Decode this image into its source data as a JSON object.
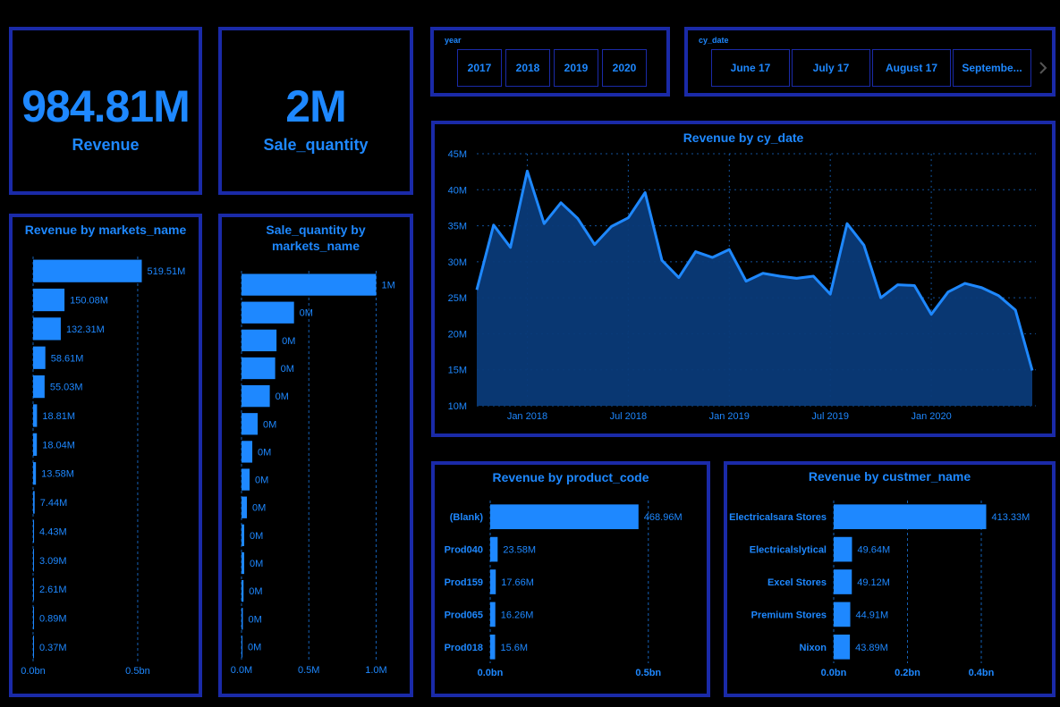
{
  "kpis": {
    "revenue": {
      "value": "984.81M",
      "label": "Revenue"
    },
    "quantity": {
      "value": "2M",
      "label": "Sale_quantity"
    }
  },
  "year_slicer": {
    "title": "year",
    "options": [
      "2017",
      "2018",
      "2019",
      "2020"
    ]
  },
  "date_slicer": {
    "title": "cy_date",
    "options": [
      "June 17",
      "July 17",
      "August 17",
      "Septembe..."
    ],
    "next_icon": "chevron-right-icon"
  },
  "colors": {
    "accent": "#1e88ff",
    "border": "#1a2aa8",
    "area_fill": "#0a3a78",
    "background": "#000000"
  },
  "chart_data": [
    {
      "id": "revenue_by_market",
      "type": "bar",
      "orientation": "horizontal",
      "title": "Revenue by markets_name",
      "categories": [
        "",
        "",
        "",
        "",
        "",
        "",
        "",
        "",
        "",
        "",
        "",
        "",
        "",
        ""
      ],
      "values": [
        519.51,
        150.08,
        132.31,
        58.61,
        55.03,
        18.81,
        18.04,
        13.58,
        7.44,
        4.43,
        3.09,
        2.61,
        0.89,
        0.37
      ],
      "data_labels": [
        "519.51M",
        "150.08M",
        "132.31M",
        "58.61M",
        "55.03M",
        "18.81M",
        "18.04M",
        "13.58M",
        "7.44M",
        "4.43M",
        "3.09M",
        "2.61M",
        "0.89M",
        "0.37M"
      ],
      "xlim": [
        0,
        620
      ],
      "xticks": [
        0,
        500
      ],
      "xtick_labels": [
        "0.0bn",
        "0.5bn"
      ],
      "grid": true
    },
    {
      "id": "quantity_by_market",
      "type": "bar",
      "orientation": "horizontal",
      "title": "Sale_quantity by markets_name",
      "categories": [
        "",
        "",
        "",
        "",
        "",
        "",
        "",
        "",
        "",
        "",
        "",
        "",
        "",
        ""
      ],
      "values": [
        1.0,
        0.39,
        0.26,
        0.25,
        0.21,
        0.12,
        0.08,
        0.06,
        0.04,
        0.02,
        0.02,
        0.015,
        0.01,
        0.005
      ],
      "data_labels": [
        "1M",
        "0M",
        "0M",
        "0M",
        "0M",
        "0M",
        "0M",
        "0M",
        "0M",
        "0M",
        "0M",
        "0M",
        "0M",
        "0M"
      ],
      "xlim": [
        0,
        1.05
      ],
      "xticks": [
        0,
        0.5,
        1.0
      ],
      "xtick_labels": [
        "0.0M",
        "0.5M",
        "1.0M"
      ],
      "grid": true
    },
    {
      "id": "revenue_by_date",
      "type": "area",
      "title": "Revenue by cy_date",
      "x": [
        "2017-10",
        "2017-11",
        "2017-12",
        "2018-01",
        "2018-02",
        "2018-03",
        "2018-04",
        "2018-05",
        "2018-06",
        "2018-07",
        "2018-08",
        "2018-09",
        "2018-10",
        "2018-11",
        "2018-12",
        "2019-01",
        "2019-02",
        "2019-03",
        "2019-04",
        "2019-05",
        "2019-06",
        "2019-07",
        "2019-08",
        "2019-09",
        "2019-10",
        "2019-11",
        "2019-12",
        "2020-01",
        "2020-02",
        "2020-03",
        "2020-04",
        "2020-05",
        "2020-06"
      ],
      "values": [
        26.1,
        35.1,
        32.0,
        42.6,
        35.3,
        38.2,
        36.0,
        32.4,
        34.9,
        36.1,
        39.6,
        30.2,
        27.8,
        31.4,
        30.6,
        31.7,
        27.3,
        28.4,
        28.0,
        27.7,
        28.0,
        25.5,
        35.3,
        32.3,
        25.0,
        26.8,
        26.7,
        22.7,
        25.8,
        27.0,
        26.4,
        25.3,
        23.3,
        14.9
      ],
      "yticks": [
        10,
        15,
        20,
        25,
        30,
        35,
        40,
        45
      ],
      "ytick_labels": [
        "10M",
        "15M",
        "20M",
        "25M",
        "30M",
        "35M",
        "40M",
        "45M"
      ],
      "xtick_labels": [
        "Jan 2018",
        "Jul 2018",
        "Jan 2019",
        "Jul 2019",
        "Jan 2020"
      ],
      "ylim": [
        10,
        45
      ],
      "grid": true
    },
    {
      "id": "revenue_by_product",
      "type": "bar",
      "orientation": "horizontal",
      "title": "Revenue by product_code",
      "categories": [
        "(Blank)",
        "Prod040",
        "Prod159",
        "Prod065",
        "Prod018"
      ],
      "values": [
        468.96,
        23.58,
        17.66,
        16.26,
        15.6
      ],
      "data_labels": [
        "468.96M",
        "23.58M",
        "17.66M",
        "16.26M",
        "15.6M"
      ],
      "xlim": [
        0,
        560
      ],
      "xticks": [
        0,
        500
      ],
      "xtick_labels": [
        "0.0bn",
        "0.5bn"
      ],
      "grid": true
    },
    {
      "id": "revenue_by_customer",
      "type": "bar",
      "orientation": "horizontal",
      "title": "Revenue by custmer_name",
      "categories": [
        "Electricalsara Stores",
        "Electricalslytical",
        "Excel Stores",
        "Premium Stores",
        "Nixon"
      ],
      "values": [
        413.33,
        49.64,
        49.12,
        44.91,
        43.89
      ],
      "data_labels": [
        "413.33M",
        "49.64M",
        "49.12M",
        "44.91M",
        "43.89M"
      ],
      "xlim": [
        0,
        480
      ],
      "xticks": [
        0,
        200,
        400
      ],
      "xtick_labels": [
        "0.0bn",
        "0.2bn",
        "0.4bn"
      ],
      "grid": true
    }
  ]
}
